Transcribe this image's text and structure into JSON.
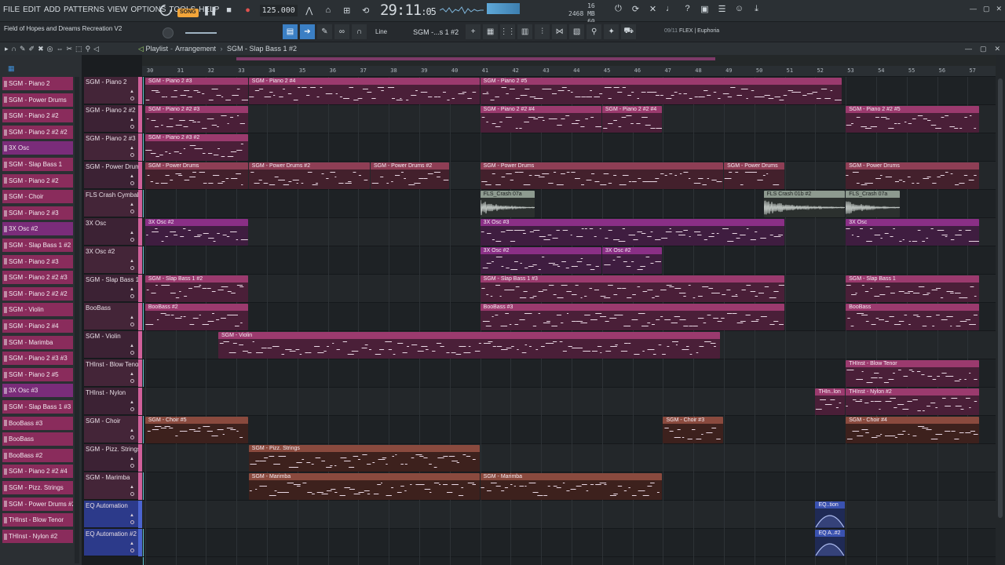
{
  "menu": [
    "FILE",
    "EDIT",
    "ADD",
    "PATTERNS",
    "VIEW",
    "OPTIONS",
    "TOOLS",
    "HELP"
  ],
  "transport": {
    "mode_label": "SONG",
    "tempo": "125.000",
    "time": "29:11",
    "time_fraction": "05",
    "cpu_bars_label": "16",
    "memory": "2468 MB",
    "polyphony": "60",
    "colors": {
      "accent": "#f2a53a",
      "playhead": "#5fc0c8"
    }
  },
  "project": {
    "name": "Field of Hopes and Dreams Recreation V2"
  },
  "toolbar2": {
    "snap_label": "Line",
    "pattern_label": "SGM -...s 1 #2",
    "plugin_counter": "09/11",
    "plugin_name": "FLEX | Euphoria"
  },
  "playlist": {
    "title": "Playlist",
    "breadcrumb_sep": "-",
    "section": "Arrangement",
    "current_pattern": "SGM - Slap Bass 1 #2"
  },
  "picker_items": [
    {
      "label": "SGM - Piano 2",
      "color": "#8a2c5c"
    },
    {
      "label": "SGM - Power Drums",
      "color": "#8a2c5c"
    },
    {
      "label": "SGM - Piano 2 #2",
      "color": "#8a2c5c"
    },
    {
      "label": "SGM - Piano 2 #2 #2",
      "color": "#8a2c5c"
    },
    {
      "label": "3X Osc",
      "color": "#7a2c7a"
    },
    {
      "label": "SGM - Slap Bass 1",
      "color": "#8a2c5c"
    },
    {
      "label": "SGM - Piano 2 #2",
      "color": "#8a2c5c"
    },
    {
      "label": "SGM - Choir",
      "color": "#8a2c5c"
    },
    {
      "label": "SGM - Piano 2 #3",
      "color": "#8a2c5c"
    },
    {
      "label": "3X Osc #2",
      "color": "#7a2c7a"
    },
    {
      "label": "SGM - Slap Bass 1 #2",
      "color": "#8a2c5c"
    },
    {
      "label": "SGM - Piano 2 #3",
      "color": "#8a2c5c"
    },
    {
      "label": "SGM - Piano 2 #2 #3",
      "color": "#8a2c5c"
    },
    {
      "label": "SGM - Piano 2 #2 #2",
      "color": "#8a2c5c"
    },
    {
      "label": "SGM - Violin",
      "color": "#8a2c5c"
    },
    {
      "label": "SGM - Piano 2 #4",
      "color": "#8a2c5c"
    },
    {
      "label": "SGM - Marimba",
      "color": "#8a2c5c"
    },
    {
      "label": "SGM - Piano 2 #3 #3",
      "color": "#8a2c5c"
    },
    {
      "label": "SGM - Piano 2 #5",
      "color": "#8a2c5c"
    },
    {
      "label": "3X Osc #3",
      "color": "#7a2c7a"
    },
    {
      "label": "SGM - Slap Bass 1 #3",
      "color": "#8a2c5c"
    },
    {
      "label": "BooBass #3",
      "color": "#8a2c5c"
    },
    {
      "label": "BooBass",
      "color": "#8a2c5c"
    },
    {
      "label": "BooBass #2",
      "color": "#8a2c5c"
    },
    {
      "label": "SGM - Piano 2 #2 #4",
      "color": "#8a2c5c"
    },
    {
      "label": "SGM - Pizz. Strings",
      "color": "#8a2c5c"
    },
    {
      "label": "SGM - Power Drums #2",
      "color": "#8a2c5c"
    },
    {
      "label": "THInst - Blow Tenor",
      "color": "#8a2c5c"
    },
    {
      "label": "THInst - Nylon #2",
      "color": "#8a2c5c"
    }
  ],
  "ruler_bars": [
    "30",
    "31",
    "32",
    "33",
    "34",
    "35",
    "36",
    "37",
    "38",
    "39",
    "40",
    "41",
    "42",
    "43",
    "44",
    "45",
    "46",
    "47",
    "48",
    "49",
    "50",
    "51",
    "52",
    "53",
    "54",
    "55",
    "56",
    "57"
  ],
  "tracks": [
    {
      "label": "SGM - Piano 2"
    },
    {
      "label": "SGM - Piano 2 #2"
    },
    {
      "label": "SGM - Piano 2 #3"
    },
    {
      "label": "SGM - Power Drums"
    },
    {
      "label": "FLS Crash Cymbal"
    },
    {
      "label": "3X Osc"
    },
    {
      "label": "3X Osc #2"
    },
    {
      "label": "SGM - Slap Bass 1"
    },
    {
      "label": "BooBass"
    },
    {
      "label": "SGM - Violin"
    },
    {
      "label": "THInst - Blow Tenor"
    },
    {
      "label": "THInst - Nylon"
    },
    {
      "label": "SGM - Choir"
    },
    {
      "label": "SGM - Pizz. Strings"
    },
    {
      "label": "SGM - Marimba"
    },
    {
      "label": "EQ Automation"
    },
    {
      "label": "EQ Automation #2"
    }
  ],
  "clips": [
    {
      "track": 0,
      "start": 30,
      "end": 33.4,
      "name": "SGM - Piano 2 #3",
      "style": "c-pink"
    },
    {
      "track": 0,
      "start": 33.4,
      "end": 41.0,
      "name": "SGM - Piano 2 #4",
      "style": "c-pink"
    },
    {
      "track": 0,
      "start": 41.0,
      "end": 52.9,
      "name": "SGM - Piano 2 #5",
      "style": "c-pink"
    },
    {
      "track": 1,
      "start": 30,
      "end": 33.4,
      "name": "SGM - Piano 2 #2 #3",
      "style": "c-pink"
    },
    {
      "track": 1,
      "start": 41.0,
      "end": 45.0,
      "name": "SGM - Piano 2 #2 #4",
      "style": "c-pink"
    },
    {
      "track": 1,
      "start": 45.0,
      "end": 47.0,
      "name": "SGM - Piano 2 #2 #4",
      "style": "c-pink"
    },
    {
      "track": 1,
      "start": 53.0,
      "end": 57.4,
      "name": "SGM - Piano 2 #2 #5",
      "style": "c-pink"
    },
    {
      "track": 2,
      "start": 30,
      "end": 33.4,
      "name": "SGM - Piano 2 #3 #2",
      "style": "c-pink"
    },
    {
      "track": 3,
      "start": 30,
      "end": 33.4,
      "name": "SGM - Power Drums",
      "style": "c-rose"
    },
    {
      "track": 3,
      "start": 33.4,
      "end": 37.4,
      "name": "SGM - Power Drums #2",
      "style": "c-rose"
    },
    {
      "track": 3,
      "start": 37.4,
      "end": 40.0,
      "name": "SGM - Power Drums #2",
      "style": "c-rose"
    },
    {
      "track": 3,
      "start": 41.0,
      "end": 49.0,
      "name": "SGM - Power Drums",
      "style": "c-rose"
    },
    {
      "track": 3,
      "start": 49.0,
      "end": 51.0,
      "name": "SGM - Power Drums",
      "style": "c-rose"
    },
    {
      "track": 3,
      "start": 53.0,
      "end": 57.4,
      "name": "SGM - Power Drums",
      "style": "c-rose"
    },
    {
      "track": 4,
      "start": 41.0,
      "end": 42.8,
      "name": "FLS_Crash 07a",
      "style": "c-grey",
      "kind": "audio"
    },
    {
      "track": 4,
      "start": 50.3,
      "end": 53.0,
      "name": "FLS Crash 01b #2",
      "style": "c-grey",
      "kind": "audio"
    },
    {
      "track": 4,
      "start": 53.0,
      "end": 54.8,
      "name": "FLS_Crash 07a",
      "style": "c-grey",
      "kind": "audio"
    },
    {
      "track": 5,
      "start": 30,
      "end": 33.4,
      "name": "3X Osc #2",
      "style": "c-purp"
    },
    {
      "track": 5,
      "start": 41.0,
      "end": 51.0,
      "name": "3X Osc #3",
      "style": "c-purp"
    },
    {
      "track": 5,
      "start": 53.0,
      "end": 57.4,
      "name": "3X Osc",
      "style": "c-purp"
    },
    {
      "track": 6,
      "start": 41.0,
      "end": 45.0,
      "name": "3X Osc #2",
      "style": "c-purp"
    },
    {
      "track": 6,
      "start": 45.0,
      "end": 47.0,
      "name": "3X Osc #2",
      "style": "c-purp"
    },
    {
      "track": 7,
      "start": 30,
      "end": 33.4,
      "name": "SGM - Slap Bass 1 #2",
      "style": "c-pink"
    },
    {
      "track": 7,
      "start": 41.0,
      "end": 51.0,
      "name": "SGM - Slap Bass 1 #3",
      "style": "c-pink"
    },
    {
      "track": 7,
      "start": 53.0,
      "end": 57.4,
      "name": "SGM - Slap Bass 1",
      "style": "c-pink"
    },
    {
      "track": 8,
      "start": 30,
      "end": 33.4,
      "name": "BooBass #2",
      "style": "c-pink"
    },
    {
      "track": 8,
      "start": 41.0,
      "end": 51.0,
      "name": "BooBass #3",
      "style": "c-pink"
    },
    {
      "track": 8,
      "start": 53.0,
      "end": 57.4,
      "name": "BooBass",
      "style": "c-pink"
    },
    {
      "track": 9,
      "start": 32.4,
      "end": 48.9,
      "name": "SGM - Violin",
      "style": "c-pink"
    },
    {
      "track": 10,
      "start": 53.0,
      "end": 57.4,
      "name": "THInst - Blow Tenor",
      "style": "c-pink"
    },
    {
      "track": 11,
      "start": 52.0,
      "end": 53.0,
      "name": "THIn..lon",
      "style": "c-pink"
    },
    {
      "track": 11,
      "start": 53.0,
      "end": 57.4,
      "name": "THInst - Nylon #2",
      "style": "c-pink"
    },
    {
      "track": 12,
      "start": 30,
      "end": 33.4,
      "name": "SGM - Choir #5",
      "style": "c-brown"
    },
    {
      "track": 12,
      "start": 47.0,
      "end": 49.0,
      "name": "SGM - Choir #3",
      "style": "c-brown"
    },
    {
      "track": 12,
      "start": 53.0,
      "end": 57.4,
      "name": "SGM - Choir #4",
      "style": "c-brown"
    },
    {
      "track": 13,
      "start": 33.4,
      "end": 41.0,
      "name": "SGM - Pizz. Strings",
      "style": "c-brown"
    },
    {
      "track": 14,
      "start": 33.4,
      "end": 41.0,
      "name": "SGM - Marimba",
      "style": "c-brown"
    },
    {
      "track": 14,
      "start": 41.0,
      "end": 47.0,
      "name": "SGM - Marimba",
      "style": "c-brown"
    },
    {
      "track": 15,
      "start": 52.0,
      "end": 53.0,
      "name": "EQ..tion",
      "style": "c-blue",
      "kind": "auto"
    },
    {
      "track": 16,
      "start": 52.0,
      "end": 53.0,
      "name": "EQ A..#2",
      "style": "c-blue",
      "kind": "auto"
    }
  ]
}
